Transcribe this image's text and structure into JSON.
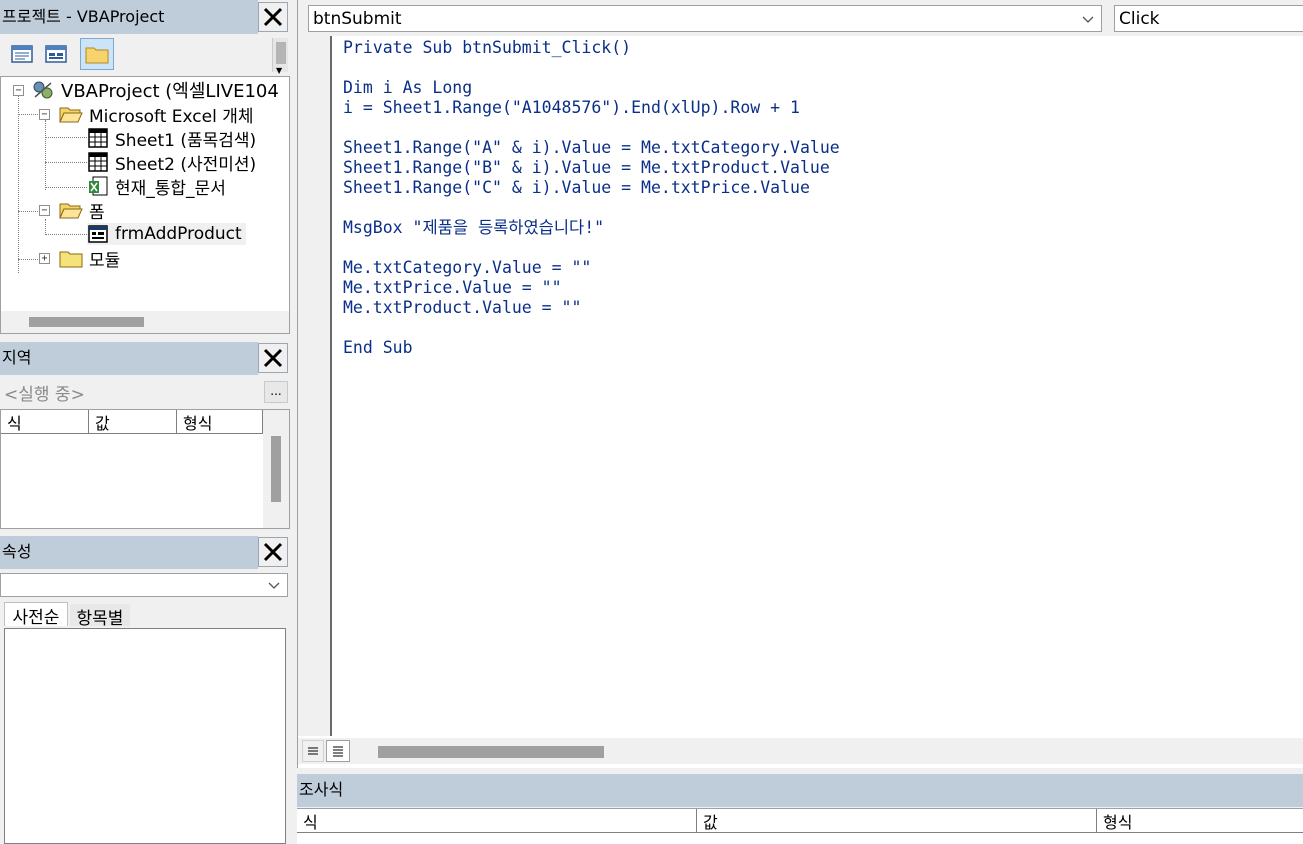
{
  "project": {
    "title": "프로젝트 - VBAProject",
    "root": "VBAProject (엑셀LIVE104",
    "folder_objects": "Microsoft Excel 개체",
    "sheet1": "Sheet1 (품목검색)",
    "sheet2": "Sheet2 (사전미션)",
    "workbook": "현재_통합_문서",
    "folder_forms": "폼",
    "form1": "frmAddProduct",
    "folder_modules": "모듈"
  },
  "locals": {
    "title": "지역",
    "running": "<실행 중>",
    "ellipsis": "...",
    "col_expr": "식",
    "col_value": "값",
    "col_type": "형식"
  },
  "properties": {
    "title": "속성",
    "combo_value": "",
    "tab_alpha": "사전순",
    "tab_category": "항목별"
  },
  "editor": {
    "object_combo": "btnSubmit",
    "proc_combo": "Click",
    "code_lines": [
      "Private Sub btnSubmit_Click()",
      "",
      "Dim i As Long",
      "i = Sheet1.Range(\"A1048576\").End(xlUp).Row + 1",
      "",
      "Sheet1.Range(\"A\" & i).Value = Me.txtCategory.Value",
      "Sheet1.Range(\"B\" & i).Value = Me.txtProduct.Value",
      "Sheet1.Range(\"C\" & i).Value = Me.txtPrice.Value",
      "",
      "MsgBox \"제품을 등록하였습니다!\"",
      "",
      "Me.txtCategory.Value = \"\"",
      "Me.txtPrice.Value = \"\"",
      "Me.txtProduct.Value = \"\"",
      "",
      "End Sub"
    ]
  },
  "watch": {
    "title": "조사식",
    "col_expr": "식",
    "col_value": "값",
    "col_type": "형식"
  },
  "colors": {
    "titlebar": "#bfcddb",
    "code_text": "#0b2f88"
  }
}
